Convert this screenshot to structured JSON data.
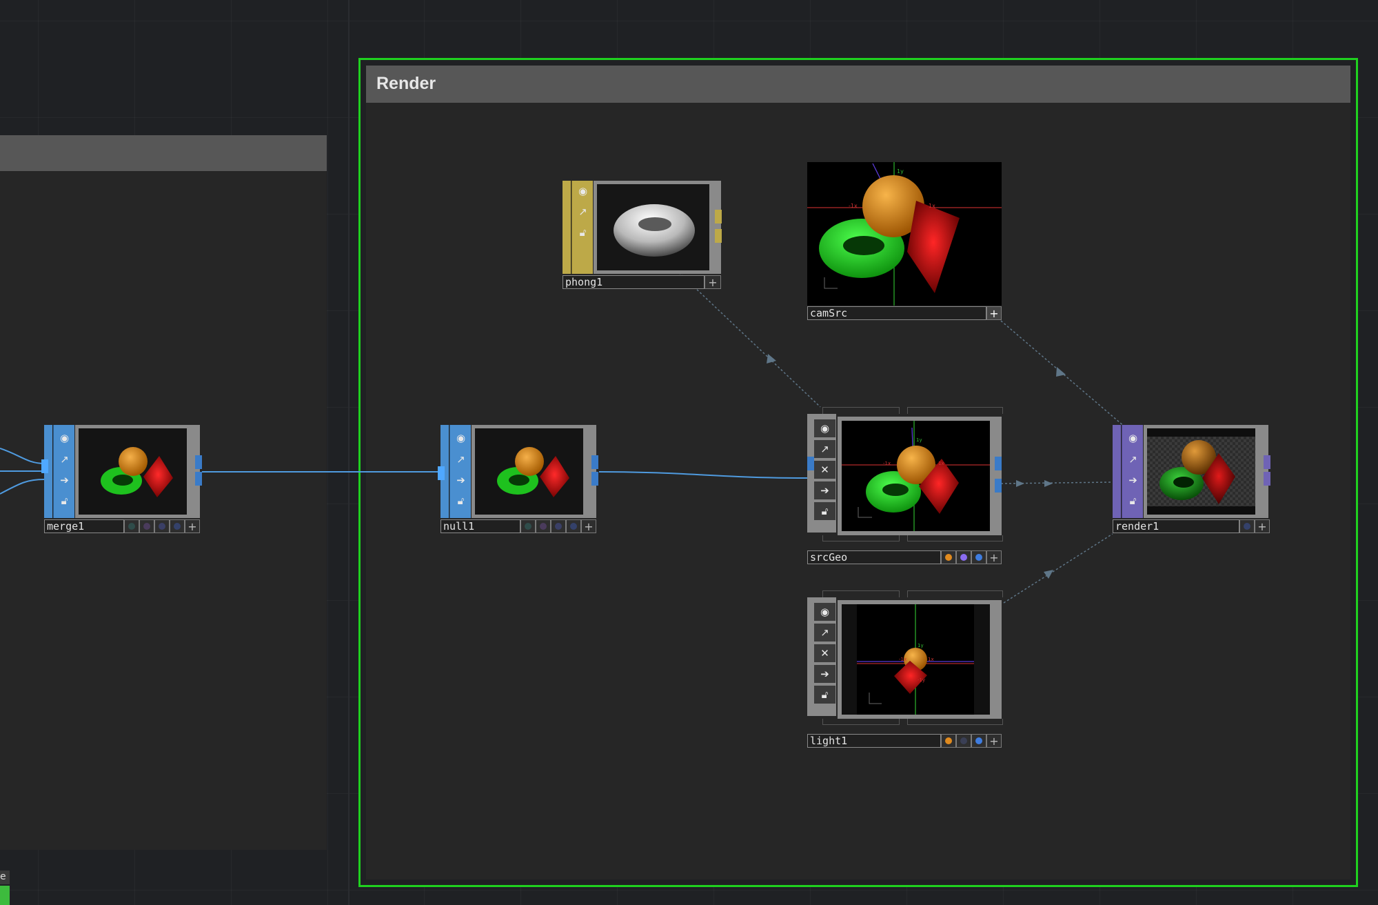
{
  "colors": {
    "background": "#1f2124",
    "render_border": "#1fd11f",
    "sop_blue": "#4a8fd0",
    "mat_yellow": "#bda948",
    "top_purple": "#6f63b5",
    "comp_gray": "#8a8a8a",
    "wire_blue": "#4f9be0",
    "wire_gray": "#5f7688"
  },
  "network": {
    "render_box": {
      "title": "Render"
    },
    "corner_tag": "e"
  },
  "nodes": {
    "merge1": {
      "name": "merge1",
      "family": "SOP",
      "icons": [
        "viewer-toggle-icon",
        "export-icon",
        "pass-through-icon",
        "lock-icon"
      ]
    },
    "null1": {
      "name": "null1",
      "family": "SOP",
      "icons": [
        "viewer-toggle-icon",
        "export-icon",
        "pass-through-icon",
        "lock-icon"
      ]
    },
    "phong1": {
      "name": "phong1",
      "family": "MAT",
      "icons": [
        "viewer-toggle-icon",
        "export-icon",
        "lock-icon"
      ]
    },
    "camSrc": {
      "name": "camSrc",
      "family": "COMP"
    },
    "srcGeo": {
      "name": "srcGeo",
      "family": "COMP",
      "icons": [
        "viewer-toggle-icon",
        "export-icon",
        "bypass-icon",
        "pass-through-icon",
        "lock-icon"
      ]
    },
    "light1": {
      "name": "light1",
      "family": "COMP",
      "icons": [
        "viewer-toggle-icon",
        "export-icon",
        "bypass-icon",
        "pass-through-icon",
        "lock-icon"
      ]
    },
    "render1": {
      "name": "render1",
      "family": "TOP",
      "icons": [
        "viewer-toggle-icon",
        "export-icon",
        "pass-through-icon",
        "lock-icon"
      ]
    }
  },
  "flag_colors": {
    "render_on": "#e08a1e",
    "instance_on": "#8a6cf0",
    "display_on": "#3f7de0",
    "off": "#3a3f55"
  }
}
